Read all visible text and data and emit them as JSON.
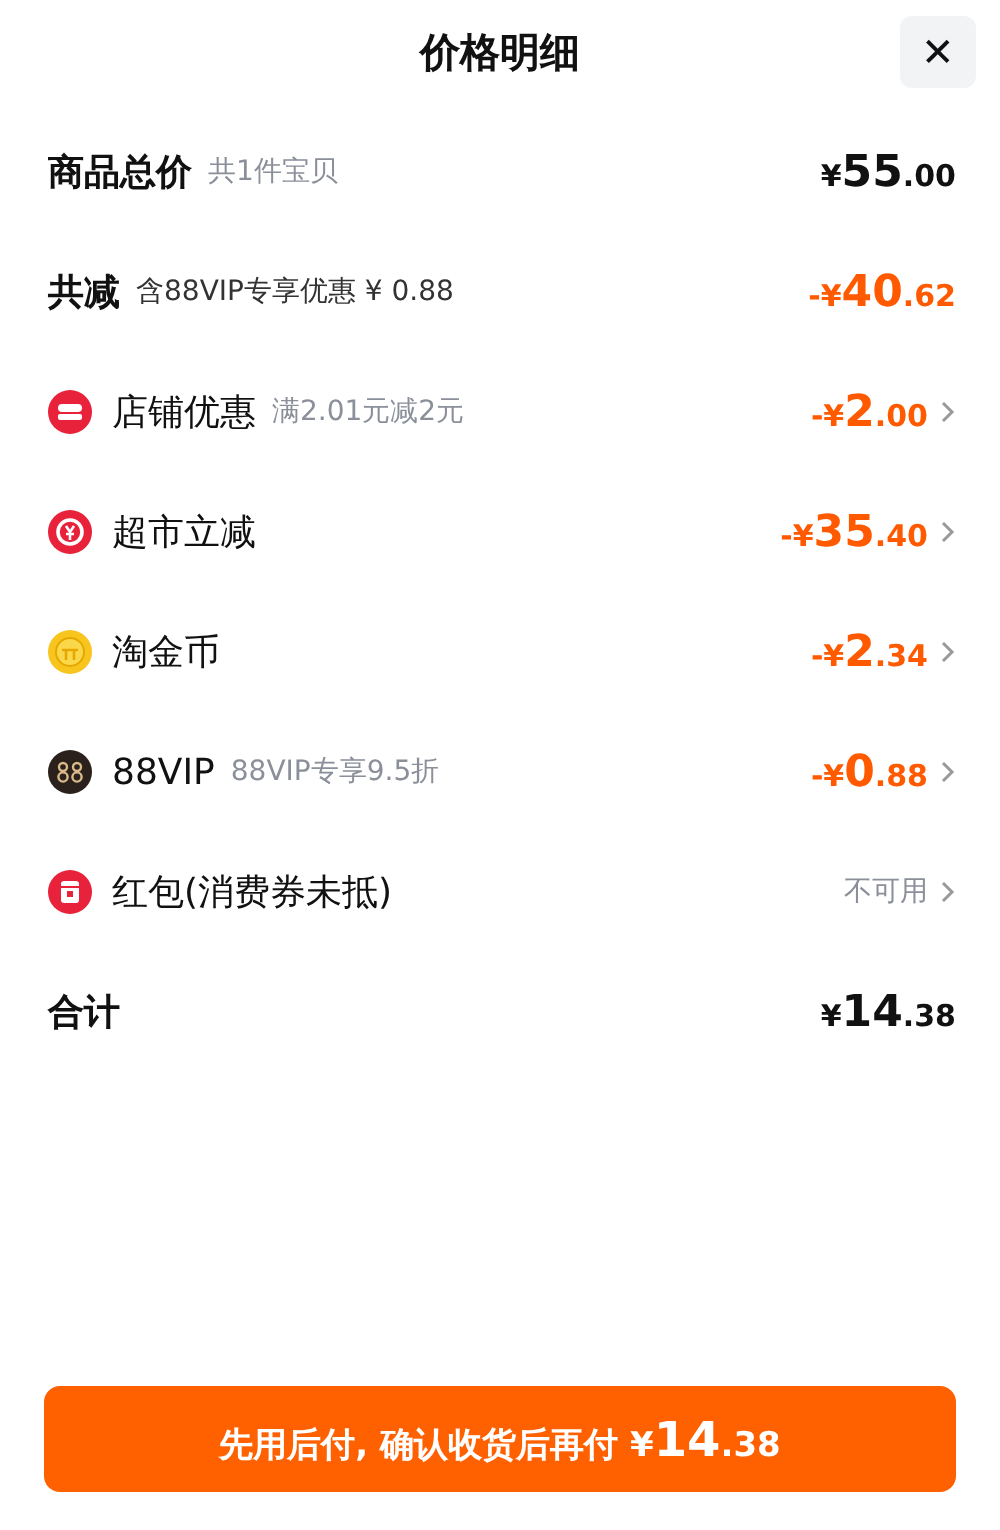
{
  "title": "价格明细",
  "close": "✕",
  "rows": [
    {
      "kind": "summary",
      "label": "商品总价",
      "note": "共1件宝贝",
      "price": {
        "kind": "charge",
        "sign": "¥",
        "whole": "55",
        "fraction": ".00"
      },
      "chevron": false
    },
    {
      "kind": "reduction",
      "label": "共减",
      "note": "含88VIP专享优惠 ¥ 0.88",
      "price": {
        "kind": "discount",
        "sign": "-¥",
        "whole": "40",
        "fraction": ".62"
      },
      "chevron": false
    },
    {
      "kind": "shop",
      "label": "店铺优惠",
      "note": "满2.01元减2元",
      "price": {
        "kind": "discount",
        "sign": "-¥",
        "whole": "2",
        "fraction": ".00"
      },
      "chevron": true
    },
    {
      "kind": "market",
      "label": "超市立减",
      "price": {
        "kind": "discount",
        "sign": "-¥",
        "whole": "35",
        "fraction": ".40"
      },
      "chevron": true
    },
    {
      "kind": "coin",
      "label": "淘金币",
      "price": {
        "kind": "discount",
        "sign": "-¥",
        "whole": "2",
        "fraction": ".34"
      },
      "chevron": true
    },
    {
      "kind": "vip",
      "label": "88VIP",
      "note": "88VIP专享9.5折",
      "price": {
        "kind": "discount",
        "sign": "-¥",
        "whole": "0",
        "fraction": ".88"
      },
      "chevron": true
    },
    {
      "kind": "redpacket",
      "label": "红包(消费券未抵)",
      "status": "不可用",
      "chevron": true
    },
    {
      "kind": "summary",
      "label": "合计",
      "price": {
        "kind": "charge",
        "sign": "¥",
        "whole": "14",
        "fraction": ".38"
      },
      "chevron": false
    }
  ],
  "button": {
    "label": "先用后付, 确认收货后再付",
    "sign": "¥",
    "whole": "14",
    "fraction": ".38"
  }
}
